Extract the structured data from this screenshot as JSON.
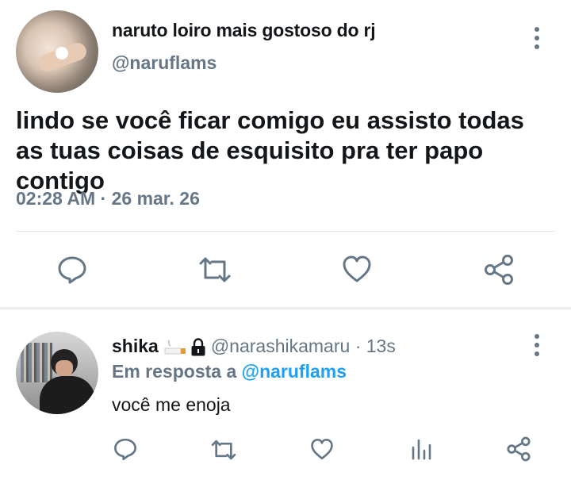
{
  "tweet": {
    "author_name": "naruto loiro mais gostoso do rj",
    "author_handle": "@naruflams",
    "text": "lindo se você ficar comigo eu assisto todas as tuas coisas de esquisito pra ter papo contigo",
    "time": "02:28 AM",
    "date": "26 mar. 26",
    "meta_separator": " · "
  },
  "reply": {
    "author_name": "shika",
    "author_handle": "@narashikamaru",
    "age": "· 13s",
    "replying_prefix": "Em resposta a ",
    "replying_to": "@naruflams",
    "text": "você me enoja"
  },
  "icons": {
    "main_actions": [
      "reply-icon",
      "retweet-icon",
      "like-icon",
      "share-icon"
    ],
    "reply_actions": [
      "reply-icon",
      "retweet-icon",
      "like-icon",
      "analytics-icon",
      "share-icon"
    ],
    "badges": [
      "cigarette-emoji",
      "lock-icon"
    ]
  },
  "colors": {
    "text_primary": "#14171a",
    "text_secondary": "#657786",
    "link": "#1da1f2",
    "divider": "#e1e8ed"
  }
}
